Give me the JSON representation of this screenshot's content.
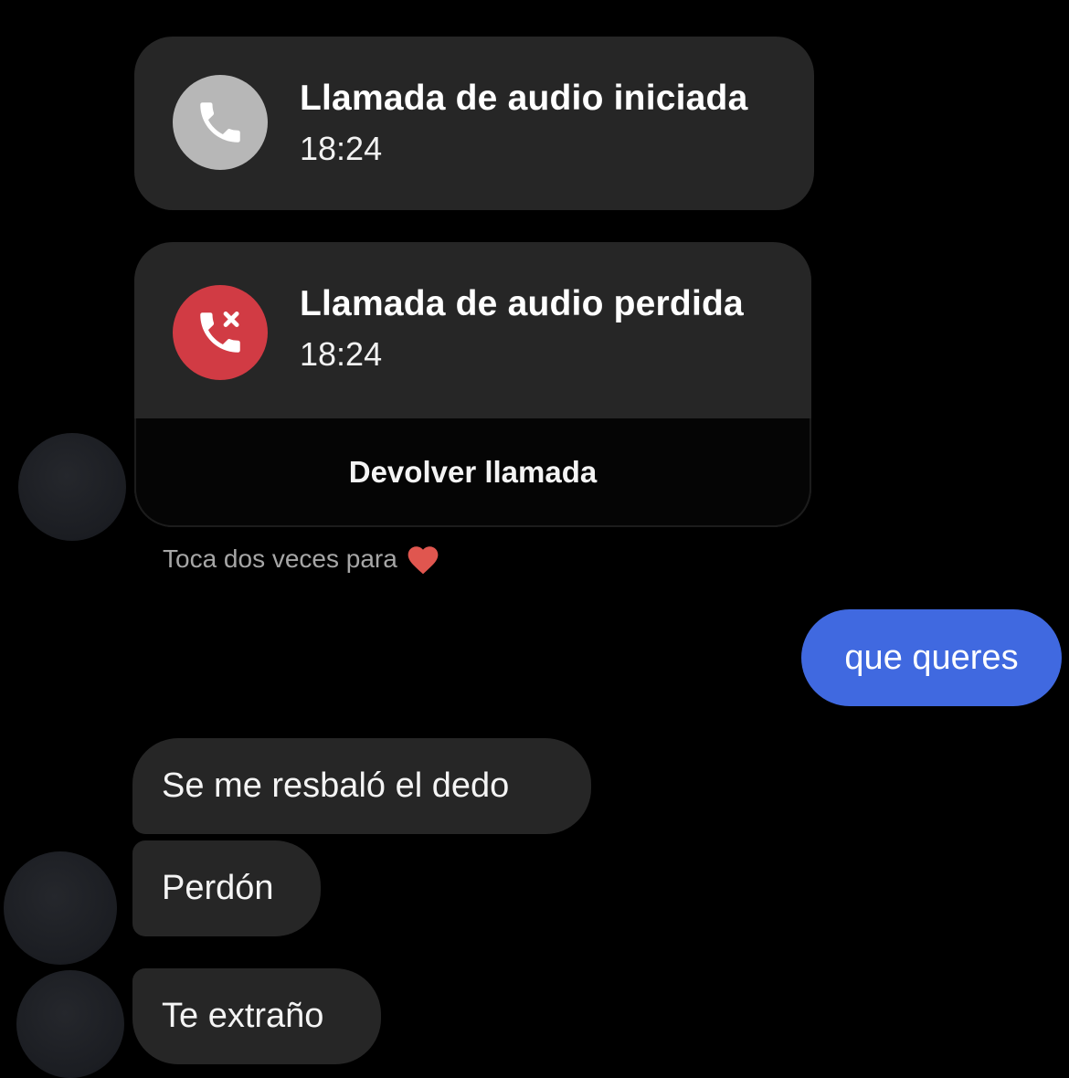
{
  "calls": [
    {
      "title": "Llamada de audio iniciada",
      "time": "18:24",
      "icon": "phone-icon",
      "icon_color": "#b7b7b7"
    },
    {
      "title": "Llamada de audio perdida",
      "time": "18:24",
      "icon": "missed-call-icon",
      "icon_color": "#d13b44",
      "action_label": "Devolver llamada"
    }
  ],
  "hint": {
    "text": "Toca dos veces para",
    "icon": "heart-icon",
    "icon_color": "#e0564f"
  },
  "messages": [
    {
      "direction": "outgoing",
      "text": "que queres",
      "color": "#4069e0"
    },
    {
      "direction": "incoming",
      "text": "Se me resbaló el dedo"
    },
    {
      "direction": "incoming",
      "text": "Perdón"
    },
    {
      "direction": "incoming",
      "text": "Te extraño"
    }
  ]
}
